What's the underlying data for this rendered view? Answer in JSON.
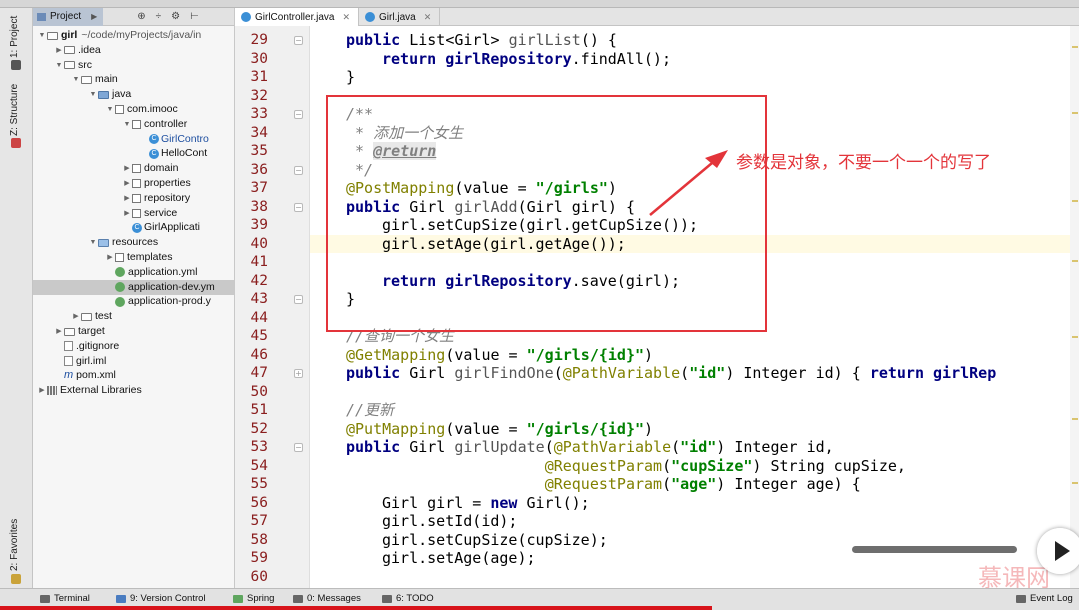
{
  "project_panel": {
    "tab_label": "Project",
    "tree": [
      {
        "label": "girl",
        "suffix": "~/code/myProjects/java/in",
        "icon": "folder-icon",
        "depth": 0,
        "arrow": "down"
      },
      {
        "label": ".idea",
        "depth": 1,
        "icon": "folder-icon",
        "arrow": "right"
      },
      {
        "label": "src",
        "depth": 1,
        "icon": "folder-icon",
        "arrow": "down"
      },
      {
        "label": "main",
        "depth": 2,
        "icon": "folder-icon",
        "arrow": "down"
      },
      {
        "label": "java",
        "depth": 3,
        "icon": "source-folder-icon",
        "arrow": "down"
      },
      {
        "label": "com.imooc",
        "depth": 4,
        "icon": "package-icon",
        "arrow": "down"
      },
      {
        "label": "controller",
        "depth": 5,
        "icon": "package-icon",
        "arrow": "down"
      },
      {
        "label": "GirlContro",
        "depth": 6,
        "icon": "class-icon",
        "arrow": "",
        "style": "blue"
      },
      {
        "label": "HelloCont",
        "depth": 6,
        "icon": "class-icon",
        "arrow": ""
      },
      {
        "label": "domain",
        "depth": 5,
        "icon": "package-icon",
        "arrow": "right"
      },
      {
        "label": "properties",
        "depth": 5,
        "icon": "package-icon",
        "arrow": "right"
      },
      {
        "label": "repository",
        "depth": 5,
        "icon": "package-icon",
        "arrow": "right"
      },
      {
        "label": "service",
        "depth": 5,
        "icon": "package-icon",
        "arrow": "right"
      },
      {
        "label": "GirlApplicati",
        "depth": 5,
        "icon": "spring-class-icon",
        "arrow": ""
      },
      {
        "label": "resources",
        "depth": 3,
        "icon": "resources-folder-icon",
        "arrow": "down"
      },
      {
        "label": "templates",
        "depth": 4,
        "icon": "package-icon",
        "arrow": "right"
      },
      {
        "label": "application.yml",
        "depth": 4,
        "icon": "yml-file-icon",
        "arrow": ""
      },
      {
        "label": "application-dev.ym",
        "depth": 4,
        "icon": "yml-file-icon",
        "arrow": "",
        "selected": true
      },
      {
        "label": "application-prod.y",
        "depth": 4,
        "icon": "yml-file-icon",
        "arrow": ""
      },
      {
        "label": "test",
        "depth": 2,
        "icon": "folder-icon",
        "arrow": "right"
      },
      {
        "label": "target",
        "depth": 1,
        "icon": "folder-icon",
        "arrow": "right"
      },
      {
        "label": ".gitignore",
        "depth": 1,
        "icon": "file-icon",
        "arrow": ""
      },
      {
        "label": "girl.iml",
        "depth": 1,
        "icon": "file-icon",
        "arrow": ""
      },
      {
        "label": "pom.xml",
        "depth": 1,
        "icon": "maven-file-icon",
        "arrow": "",
        "prefix": "m"
      },
      {
        "label": "External Libraries",
        "depth": 0,
        "icon": "library-icon",
        "arrow": "right"
      }
    ]
  },
  "left_stripe": {
    "project_tab": "1: Project",
    "structure_tab": "Z: Structure",
    "favorites_tab": "2: Favorites"
  },
  "editor_tabs": [
    {
      "label": "GirlController.java",
      "active": true
    },
    {
      "label": "Girl.java",
      "active": false
    }
  ],
  "code_lines": [
    {
      "n": "29",
      "html": "<span class=\"kw\">public</span> List&lt;Girl&gt; <span class=\"dimname\">girlList</span>() {",
      "indent": 0
    },
    {
      "n": "30",
      "html": "<span class=\"kw\">return</span> <span class=\"kw\">girlRepository</span>.findAll();",
      "indent": 1
    },
    {
      "n": "31",
      "html": "}",
      "indent": 0
    },
    {
      "n": "32",
      "html": "",
      "indent": 0
    },
    {
      "n": "33",
      "html": "<span class=\"cmt\">/**</span>",
      "indent": 0
    },
    {
      "n": "34",
      "html": "<span class=\"cmt\"> * 添加一个女生</span>",
      "indent": 0
    },
    {
      "n": "35",
      "html": "<span class=\"cmt\"> * </span><span class=\"ctag\">@return</span>",
      "indent": 0
    },
    {
      "n": "36",
      "html": "<span class=\"cmt\"> */</span>",
      "indent": 0
    },
    {
      "n": "37",
      "html": "<span class=\"ann\">@PostMapping</span>(value = <span class=\"str\">\"/girls\"</span>)",
      "indent": 0
    },
    {
      "n": "38",
      "html": "<span class=\"kw\">public</span> Girl <span class=\"dimname\">girlAdd</span>(Girl girl) {",
      "indent": 0
    },
    {
      "n": "39",
      "html": "girl.setCupSize(girl.getCupSize());",
      "indent": 1
    },
    {
      "n": "40",
      "html": "girl.setAge(girl.getAge());",
      "indent": 1,
      "current": true
    },
    {
      "n": "41",
      "html": "",
      "indent": 0
    },
    {
      "n": "42",
      "html": "<span class=\"kw\">return</span> <span class=\"kw\">girlRepository</span>.save(girl);",
      "indent": 1
    },
    {
      "n": "43",
      "html": "}",
      "indent": 0
    },
    {
      "n": "44",
      "html": "",
      "indent": 0
    },
    {
      "n": "45",
      "html": "<span class=\"cmt\">//查询一个女生</span>",
      "indent": 0
    },
    {
      "n": "46",
      "html": "<span class=\"ann\">@GetMapping</span>(value = <span class=\"str\">\"/girls/{id}\"</span>)",
      "indent": 0
    },
    {
      "n": "47",
      "html": "<span class=\"kw\">public</span> Girl <span class=\"dimname\">girlFindOne</span>(<span class=\"ann\">@PathVariable</span>(<span class=\"str\">\"id\"</span>) Integer id) { <span class=\"kw\">return</span> <span class=\"kw\">girlRep</span>",
      "indent": 0
    },
    {
      "n": "50",
      "html": "",
      "indent": 0
    },
    {
      "n": "51",
      "html": "<span class=\"cmt\">//更新</span>",
      "indent": 0
    },
    {
      "n": "52",
      "html": "<span class=\"ann\">@PutMapping</span>(value = <span class=\"str\">\"/girls/{id}\"</span>)",
      "indent": 0
    },
    {
      "n": "53",
      "html": "<span class=\"kw\">public</span> Girl <span class=\"dimname\">girlUpdate</span>(<span class=\"ann\">@PathVariable</span>(<span class=\"str\">\"id\"</span>) Integer id,",
      "indent": 0
    },
    {
      "n": "54",
      "html": "                      <span class=\"ann\">@RequestParam</span>(<span class=\"str\">\"cupSize\"</span>) String cupSize,",
      "indent": 0
    },
    {
      "n": "55",
      "html": "                      <span class=\"ann\">@RequestParam</span>(<span class=\"str\">\"age\"</span>) Integer age) {",
      "indent": 0
    },
    {
      "n": "56",
      "html": "Girl girl = <span class=\"kw\">new</span> Girl();",
      "indent": 1
    },
    {
      "n": "57",
      "html": "girl.setId(id);",
      "indent": 1
    },
    {
      "n": "58",
      "html": "girl.setCupSize(cupSize);",
      "indent": 1
    },
    {
      "n": "59",
      "html": "girl.setAge(age);",
      "indent": 1
    },
    {
      "n": "60",
      "html": "",
      "indent": 0
    }
  ],
  "annotation": {
    "text": "参数是对象，不要一个一个的写了",
    "color": "#e3343a"
  },
  "bottom_tools": [
    {
      "label": "Terminal",
      "icon": "terminal-icon"
    },
    {
      "label": "9: Version Control",
      "icon": "version-control-icon"
    },
    {
      "label": "Spring",
      "icon": "spring-icon"
    },
    {
      "label": "0: Messages",
      "icon": "messages-icon"
    },
    {
      "label": "6: TODO",
      "icon": "todo-icon"
    },
    {
      "label": "Event Log",
      "icon": "event-log-icon"
    }
  ],
  "watermark": "慕课网"
}
